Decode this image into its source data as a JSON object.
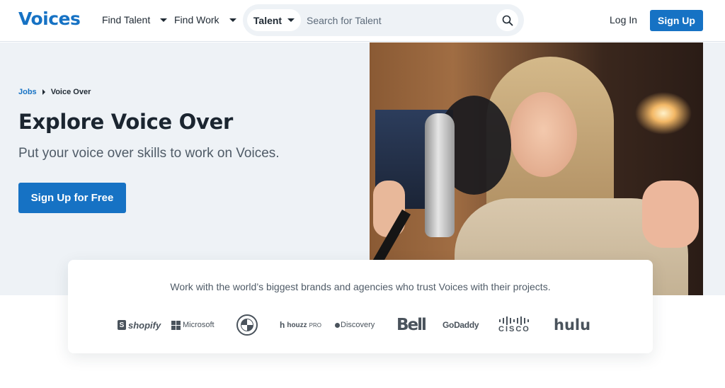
{
  "header": {
    "logo": "Voices",
    "nav": [
      {
        "label": "Find Talent"
      },
      {
        "label": "Find Work"
      }
    ],
    "search": {
      "type_selected": "Talent",
      "placeholder": "Search for Talent",
      "value": ""
    },
    "login_label": "Log In",
    "signup_label": "Sign Up"
  },
  "hero": {
    "breadcrumb": [
      {
        "label": "Jobs"
      },
      {
        "label": "Voice Over"
      }
    ],
    "title": "Explore Voice Over",
    "subtitle": "Put your voice over skills to work on Voices.",
    "cta_label": "Sign Up for Free",
    "image_description": "Woman smiling at a studio microphone with pop filter"
  },
  "brands": {
    "text": "Work with the world’s biggest brands and agencies who trust Voices with their projects.",
    "logos": [
      {
        "name": "shopify",
        "label": "shopify"
      },
      {
        "name": "microsoft",
        "label": "Microsoft"
      },
      {
        "name": "bmw",
        "label": "BMW"
      },
      {
        "name": "houzz-pro",
        "label": "houzz",
        "suffix": "PRO"
      },
      {
        "name": "discovery",
        "label": "Discovery"
      },
      {
        "name": "bell",
        "label": "Bell"
      },
      {
        "name": "godaddy",
        "label": "GoDaddy"
      },
      {
        "name": "cisco",
        "label": "CISCO"
      },
      {
        "name": "hulu",
        "label": "hulu"
      }
    ]
  },
  "colors": {
    "brand_blue": "#1672c4",
    "hero_bg": "#eef2f6",
    "text_dark": "#1b2530",
    "text_muted": "#4f5b67",
    "logo_gray": "#4a535c"
  }
}
